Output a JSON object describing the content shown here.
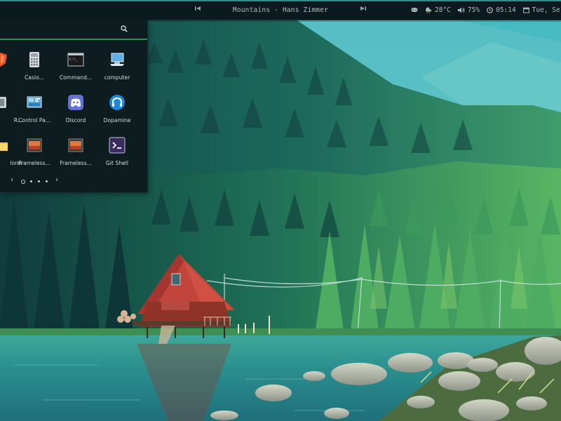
{
  "topbar": {
    "now_playing": "Mountains - Hans Zimmer",
    "weather": "28°C",
    "volume": "75%",
    "clock": "05:14",
    "date": "Tue, Se"
  },
  "launcher": {
    "search_placeholder": "",
    "apps": [
      {
        "label": "Casio..."
      },
      {
        "label": "Command..."
      },
      {
        "label": "computer"
      },
      {
        "label": "R..."
      },
      {
        "label": "Control Pa..."
      },
      {
        "label": "Discord"
      },
      {
        "label": "Dopamine"
      },
      {
        "label": "lorer"
      },
      {
        "label": "Frameless..."
      },
      {
        "label": "Frameless..."
      },
      {
        "label": "Git Shell"
      }
    ],
    "pager": {
      "pages": 5,
      "current": 1
    }
  }
}
